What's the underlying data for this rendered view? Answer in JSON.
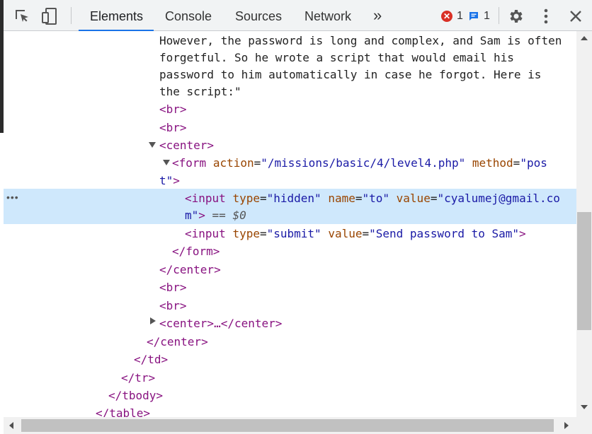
{
  "toolbar": {
    "tabs": [
      {
        "label": "Elements"
      },
      {
        "label": "Console"
      },
      {
        "label": "Sources"
      },
      {
        "label": "Network"
      }
    ],
    "more_label": "»",
    "errors_count": "1",
    "messages_count": "1"
  },
  "content": {
    "text_lines": [
      "However, the password is long and complex, and Sam is often",
      "forgetful. So he wrote a script that would email his",
      "password to him automatically in case he forgot. Here is",
      "the script:\""
    ],
    "br": "<br>",
    "center_open": "<center>",
    "center_close": "</center>",
    "form_open_start": "<form",
    "action_attr": "action",
    "action_value": "\"/missions/basic/4/level4.php\"",
    "method_attr": "method",
    "method_value_a": "\"pos",
    "method_value_b": "t\"",
    "gt": ">",
    "input_open": "<input",
    "type_attr": "type",
    "type_hidden": "\"hidden\"",
    "name_attr": "name",
    "name_value": "\"to\"",
    "value_attr": "value",
    "value_email_a": "\"cyalumej@gmail.co",
    "value_email_b": "m\"",
    "selected_marker": "== $0",
    "type_submit": "\"submit\"",
    "submit_value": "\"Send password to Sam\"",
    "form_close": "</form>",
    "collapsed_center": "<center>…</center>",
    "td_close": "</td>",
    "tr_close": "</tr>",
    "tbody_close": "</tbody>",
    "table_close": "</table>",
    "dots": "•••"
  }
}
